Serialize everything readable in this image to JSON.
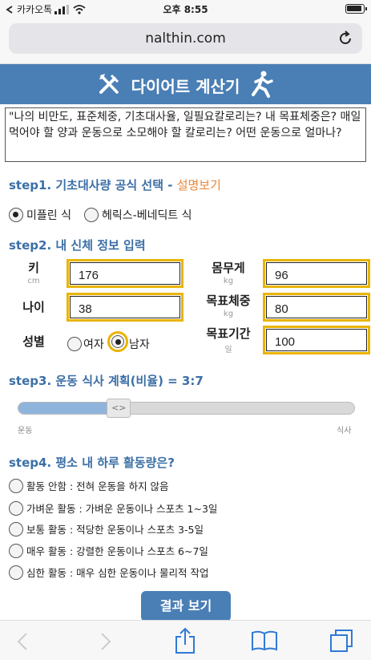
{
  "status": {
    "carrier": "카카오톡",
    "time": "오후 8:55"
  },
  "browser": {
    "url": "nalthin.com"
  },
  "header": {
    "title": "다이어트 계산기"
  },
  "intro": "\"나의 비만도, 표준체중, 기초대사율, 일필요칼로리는? 내 목표체중은? 매일 먹어야 할 양과 운동으로 소모해야 할 칼로리는? 어떤 운동으로 얼마나?",
  "step1": {
    "title": "step1. 기초대사량 공식 선택 - ",
    "link": "설명보기",
    "options": [
      "미플린 식",
      "헤릭스-베네딕트 식"
    ],
    "selected": 0
  },
  "step2": {
    "title": "step2. 내 신체 정보 입력",
    "height": {
      "label": "키",
      "unit": "cm",
      "value": "176"
    },
    "age": {
      "label": "나이",
      "value": "38"
    },
    "gender": {
      "label": "성별",
      "options": [
        "여자",
        "남자"
      ],
      "selected": 1
    },
    "weight": {
      "label": "몸무게",
      "unit": "kg",
      "value": "96"
    },
    "target_weight": {
      "label": "목표체중",
      "unit": "kg",
      "value": "80"
    },
    "target_period": {
      "label": "목표기간",
      "unit": "일",
      "value": "100"
    }
  },
  "step3": {
    "title": "step3. 운동 식사 계획(비율) = 3:7",
    "min_label": "운동",
    "max_label": "식사",
    "thumb": "<>",
    "ratio": 0.3
  },
  "step4": {
    "title": "step4. 평소 내 하루 활동량은?",
    "options": [
      "활동 안함 : 전혀 운동을 하지 않음",
      "가벼운 활동 : 가벼운 운동이나 스포츠 1~3일",
      "보통 활동 : 적당한 운동이나 스포츠 3-5일",
      "매우 활동 : 강렬한 운동이나 스포츠 6~7일",
      "심한 활동 : 매우 심한 운동이나 물리적 작업"
    ]
  },
  "result_button": "결과 보기"
}
